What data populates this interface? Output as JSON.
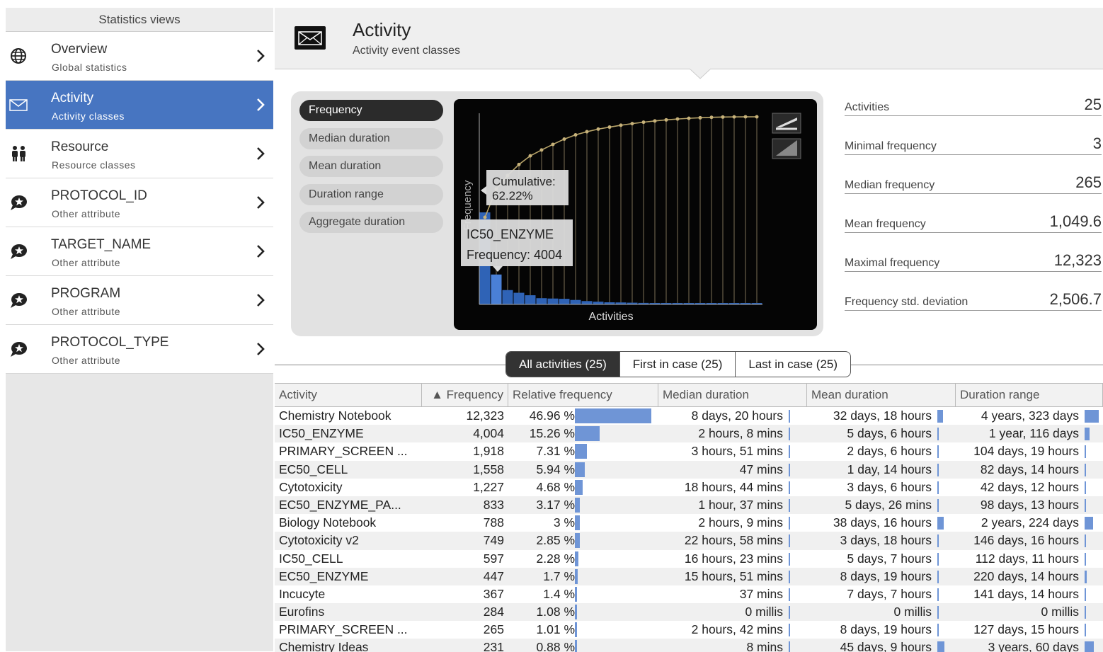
{
  "sidebar": {
    "header": "Statistics views",
    "items": [
      {
        "title": "Overview",
        "subtitle": "Global statistics",
        "icon": "globe-icon"
      },
      {
        "title": "Activity",
        "subtitle": "Activity classes",
        "icon": "envelope-icon",
        "active": true
      },
      {
        "title": "Resource",
        "subtitle": "Resource classes",
        "icon": "people-icon"
      },
      {
        "title": "PROTOCOL_ID",
        "subtitle": "Other attribute",
        "icon": "speech-bubble-star-icon"
      },
      {
        "title": "TARGET_NAME",
        "subtitle": "Other attribute",
        "icon": "speech-bubble-star-icon"
      },
      {
        "title": "PROGRAM",
        "subtitle": "Other attribute",
        "icon": "speech-bubble-star-icon"
      },
      {
        "title": "PROTOCOL_TYPE",
        "subtitle": "Other attribute",
        "icon": "speech-bubble-star-icon"
      }
    ]
  },
  "header": {
    "title": "Activity",
    "subtitle": "Activity event classes",
    "icon": "envelope-icon"
  },
  "metrics": [
    "Frequency",
    "Median duration",
    "Mean duration",
    "Duration range",
    "Aggregate duration"
  ],
  "metrics_active": 0,
  "chart": {
    "xlabel": "Activities",
    "ylabel": "Frequency",
    "tooltip_cumulative_label": "Cumulative:",
    "tooltip_cumulative_value": "62.22%",
    "tooltip_activity": "IC50_ENZYME",
    "tooltip_frequency": "Frequency: 4004"
  },
  "chart_data": {
    "type": "bar",
    "title": "",
    "xlabel": "Activities",
    "ylabel": "Frequency",
    "values": [
      12323,
      4004,
      1918,
      1558,
      1227,
      833,
      788,
      749,
      597,
      447,
      367,
      284,
      265,
      231,
      200,
      180,
      150,
      120,
      100,
      80,
      60,
      40,
      20,
      10,
      3
    ],
    "cumulative_series": "Cumulative",
    "highlighted_index": 1
  },
  "stats": [
    {
      "label": "Activities",
      "value": "25"
    },
    {
      "label": "Minimal frequency",
      "value": "3"
    },
    {
      "label": "Median frequency",
      "value": "265"
    },
    {
      "label": "Mean frequency",
      "value": "1,049.6"
    },
    {
      "label": "Maximal frequency",
      "value": "12,323"
    },
    {
      "label": "Frequency std. deviation",
      "value": "2,506.7"
    }
  ],
  "tabs": [
    "All activities (25)",
    "First in case (25)",
    "Last in case (25)"
  ],
  "tabs_active": 0,
  "table": {
    "columns": [
      "Activity",
      "▲ Frequency",
      "Relative frequency",
      "Median duration",
      "Mean duration",
      "Duration range"
    ],
    "rows": [
      {
        "activity": "Chemistry Notebook",
        "freq": "12,323",
        "rel": "46.96 %",
        "rel_frac": 0.4696,
        "median": "8 days, 20 hours",
        "median_frac": 0.02,
        "mean": "32 days, 18 hours",
        "mean_frac": 0.35,
        "range": "4 years, 323 days",
        "range_frac": 0.9
      },
      {
        "activity": "IC50_ENZYME",
        "freq": "4,004",
        "rel": "15.26 %",
        "rel_frac": 0.1526,
        "median": "2 hours, 8 mins",
        "median_frac": 0.01,
        "mean": "5 days, 6 hours",
        "mean_frac": 0.05,
        "range": "1 year, 116 days",
        "range_frac": 0.3
      },
      {
        "activity": "PRIMARY_SCREEN ...",
        "freq": "1,918",
        "rel": "7.31 %",
        "rel_frac": 0.0731,
        "median": "3 hours, 51 mins",
        "median_frac": 0.01,
        "mean": "2 days, 6 hours",
        "mean_frac": 0.03,
        "range": "104 days, 19 hours",
        "range_frac": 0.06
      },
      {
        "activity": "EC50_CELL",
        "freq": "1,558",
        "rel": "5.94 %",
        "rel_frac": 0.0594,
        "median": "47 mins",
        "median_frac": 0.01,
        "mean": "1 day, 14 hours",
        "mean_frac": 0.02,
        "range": "82 days, 14 hours",
        "range_frac": 0.05
      },
      {
        "activity": "Cytotoxicity",
        "freq": "1,227",
        "rel": "4.68 %",
        "rel_frac": 0.0468,
        "median": "18 hours, 44 mins",
        "median_frac": 0.01,
        "mean": "3 days, 6 hours",
        "mean_frac": 0.03,
        "range": "42 days, 12 hours",
        "range_frac": 0.03
      },
      {
        "activity": "EC50_ENZYME_PA...",
        "freq": "833",
        "rel": "3.17 %",
        "rel_frac": 0.0317,
        "median": "1 hour, 37 mins",
        "median_frac": 0.01,
        "mean": "5 days, 26 mins",
        "mean_frac": 0.05,
        "range": "98 days, 13 hours",
        "range_frac": 0.06
      },
      {
        "activity": "Biology Notebook",
        "freq": "788",
        "rel": "3 %",
        "rel_frac": 0.03,
        "median": "2 hours, 9 mins",
        "median_frac": 0.01,
        "mean": "38 days, 16 hours",
        "mean_frac": 0.4,
        "range": "2 years, 224 days",
        "range_frac": 0.55
      },
      {
        "activity": "Cytotoxicity v2",
        "freq": "749",
        "rel": "2.85 %",
        "rel_frac": 0.0285,
        "median": "22 hours, 58 mins",
        "median_frac": 0.01,
        "mean": "3 days, 18 hours",
        "mean_frac": 0.04,
        "range": "146 days, 16 hours",
        "range_frac": 0.08
      },
      {
        "activity": "IC50_CELL",
        "freq": "597",
        "rel": "2.28 %",
        "rel_frac": 0.0228,
        "median": "16 hours, 23 mins",
        "median_frac": 0.01,
        "mean": "5 days, 7 hours",
        "mean_frac": 0.05,
        "range": "112 days, 11 hours",
        "range_frac": 0.07
      },
      {
        "activity": "EC50_ENZYME",
        "freq": "447",
        "rel": "1.7 %",
        "rel_frac": 0.017,
        "median": "15 hours, 51 mins",
        "median_frac": 0.01,
        "mean": "8 days, 19 hours",
        "mean_frac": 0.08,
        "range": "220 days, 14 hours",
        "range_frac": 0.12
      },
      {
        "activity": "Incucyte",
        "freq": "367",
        "rel": "1.4 %",
        "rel_frac": 0.014,
        "median": "37 mins",
        "median_frac": 0.01,
        "mean": "7 days, 7 hours",
        "mean_frac": 0.07,
        "range": "141 days, 14 hours",
        "range_frac": 0.08
      },
      {
        "activity": "Eurofins",
        "freq": "284",
        "rel": "1.08 %",
        "rel_frac": 0.0108,
        "median": "0 millis",
        "median_frac": 0.01,
        "mean": "0 millis",
        "mean_frac": 0.01,
        "range": "0 millis",
        "range_frac": 0.01
      },
      {
        "activity": "PRIMARY_SCREEN ...",
        "freq": "265",
        "rel": "1.01 %",
        "rel_frac": 0.0101,
        "median": "2 hours, 42 mins",
        "median_frac": 0.01,
        "mean": "8 days, 19 hours",
        "mean_frac": 0.08,
        "range": "127 days, 15 hours",
        "range_frac": 0.07
      },
      {
        "activity": "Chemistry Ideas",
        "freq": "231",
        "rel": "0.88 %",
        "rel_frac": 0.0088,
        "median": "8 mins",
        "median_frac": 0.01,
        "mean": "45 days, 9 hours",
        "mean_frac": 0.45,
        "range": "3 years, 60 days",
        "range_frac": 0.6
      }
    ]
  },
  "colors": {
    "accent": "#4775c1",
    "bar": "#6f95d6",
    "chart_bar": "#2f63b6",
    "cumulative": "#b9a56a"
  }
}
